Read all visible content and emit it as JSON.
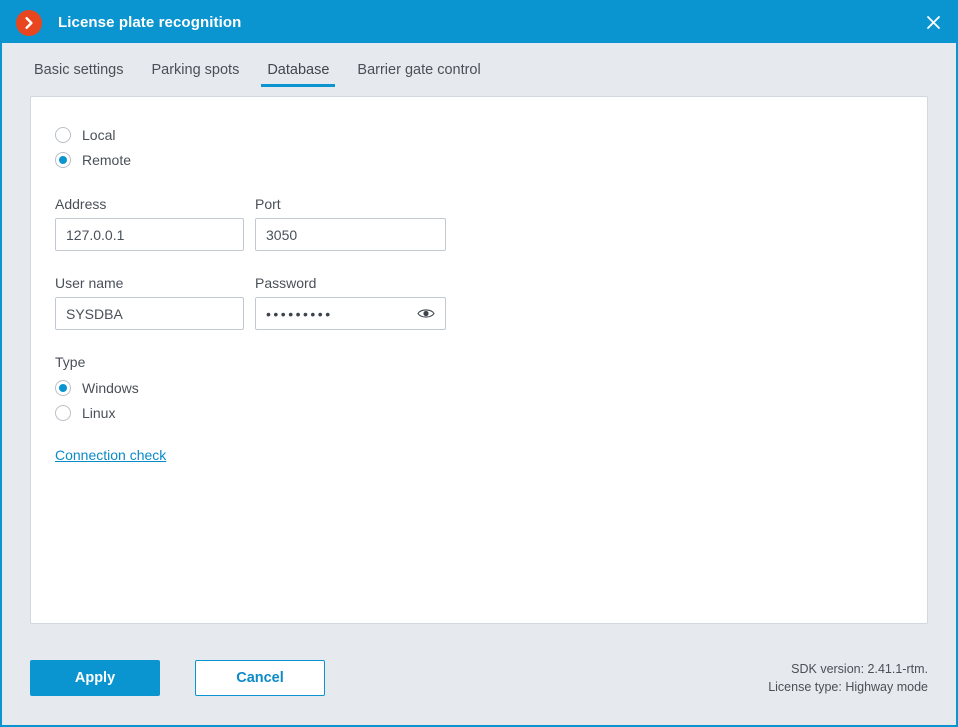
{
  "window": {
    "title": "License plate recognition",
    "logo_icon": "chevron-right-circle-icon",
    "close_icon": "close-icon",
    "accent_color": "#0b95d0",
    "logo_color": "#e8461e"
  },
  "tabs": [
    {
      "label": "Basic settings",
      "active": false
    },
    {
      "label": "Parking spots",
      "active": false
    },
    {
      "label": "Database",
      "active": true
    },
    {
      "label": "Barrier gate control",
      "active": false
    }
  ],
  "form": {
    "location": {
      "options": [
        {
          "label": "Local",
          "selected": false
        },
        {
          "label": "Remote",
          "selected": true
        }
      ]
    },
    "address": {
      "label": "Address",
      "value": "127.0.0.1"
    },
    "port": {
      "label": "Port",
      "value": "3050"
    },
    "username": {
      "label": "User name",
      "value": "SYSDBA"
    },
    "password": {
      "label": "Password",
      "value": "•••••••••",
      "reveal_icon": "eye-icon"
    },
    "type": {
      "label": "Type",
      "options": [
        {
          "label": "Windows",
          "selected": true
        },
        {
          "label": "Linux",
          "selected": false
        }
      ]
    },
    "connection_check_link": "Connection check"
  },
  "footer": {
    "apply_label": "Apply",
    "cancel_label": "Cancel",
    "sdk_version": "SDK version: 2.41.1-rtm.",
    "license_type": "License type: Highway mode"
  }
}
